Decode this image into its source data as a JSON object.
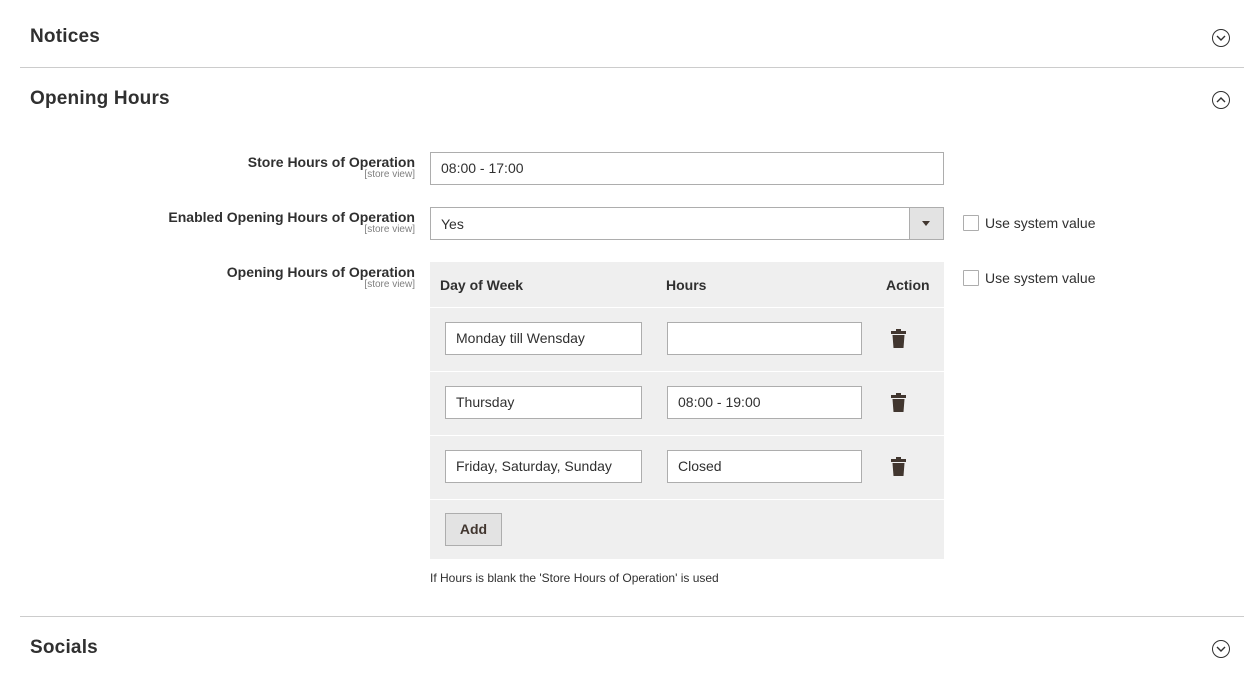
{
  "sections": {
    "notices": {
      "title": "Notices",
      "expanded": false
    },
    "opening_hours": {
      "title": "Opening Hours",
      "expanded": true
    },
    "socials": {
      "title": "Socials",
      "expanded": false
    }
  },
  "fields": {
    "store_hours": {
      "label": "Store Hours of Operation",
      "scope": "[store view]",
      "value": "08:00 - 17:00"
    },
    "enabled_hours": {
      "label": "Enabled Opening Hours of Operation",
      "scope": "[store view]",
      "value": "Yes",
      "use_system_value_label": "Use system value",
      "use_system_value_checked": false
    },
    "opening_hours": {
      "label": "Opening Hours of Operation",
      "scope": "[store view]",
      "use_system_value_label": "Use system value",
      "use_system_value_checked": false,
      "columns": {
        "day": "Day of Week",
        "hours": "Hours",
        "action": "Action"
      },
      "rows": [
        {
          "day": "Monday till Wensday",
          "hours": ""
        },
        {
          "day": "Thursday",
          "hours": "08:00 - 19:00"
        },
        {
          "day": "Friday, Saturday, Sunday",
          "hours": "Closed"
        }
      ],
      "add_label": "Add",
      "note": "If Hours is blank the 'Store Hours of Operation' is used"
    }
  },
  "icons": {
    "toggle_collapsed": "chevron-down-icon",
    "toggle_expanded": "chevron-up-icon",
    "delete": "trash-icon",
    "select_arrow": "caret-down-icon"
  },
  "colors": {
    "text": "#303030",
    "border": "#adadad",
    "divider": "#cccccc",
    "grid_bg": "#efefef",
    "button_bg": "#e3e3e3"
  }
}
